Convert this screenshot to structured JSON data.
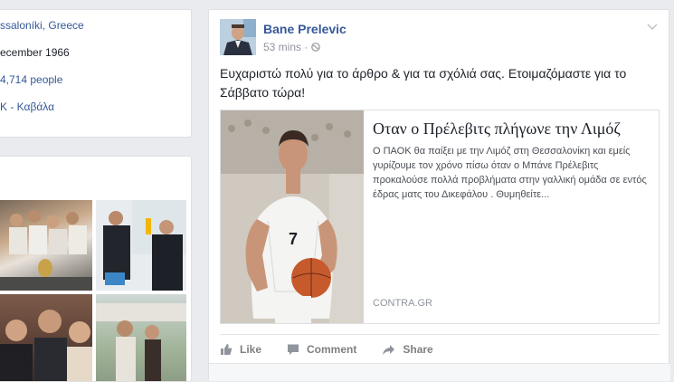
{
  "intro": {
    "rows": [
      {
        "text": "ssaloníki, Greece",
        "link": true
      },
      {
        "text": "ecember 1966",
        "link": false
      },
      {
        "text": "4,714 people",
        "link": true
      },
      {
        "text": "K - Καβάλα",
        "link": true
      }
    ]
  },
  "post": {
    "author": "Bane Prelevic",
    "time": "53 mins",
    "privacy_sep": "·",
    "privacy_icon": "globe-icon",
    "menu_icon": "chevron-down-icon",
    "text": "Ευχαριστώ πολύ για το άρθρο & για τα σχόλιά σας. Ετοιμαζόμαστε για το Σάββατο τώρα!",
    "share": {
      "title": "Οταν ο Πρέλεβιτς πλήγωνε την Λιμόζ",
      "description": "Ο ΠΑΟΚ θα παίξει με την Λιμόζ στη Θεσσαλονίκη και εμείς γυρίζουμε τον χρόνο πίσω όταν ο Μπάνε Πρέλεβιτς προκαλούσε πολλά προβλήματα στην γαλλική ομάδα σε εντός έδρας ματς του Δικεφάλου . Θυμηθείτε...",
      "source": "CONTRA.GR",
      "jersey_text": "7"
    },
    "actions": {
      "like": "Like",
      "comment": "Comment",
      "share": "Share"
    }
  },
  "colors": {
    "link": "#365899",
    "background": "#e9ebee",
    "muted": "#90949c"
  }
}
